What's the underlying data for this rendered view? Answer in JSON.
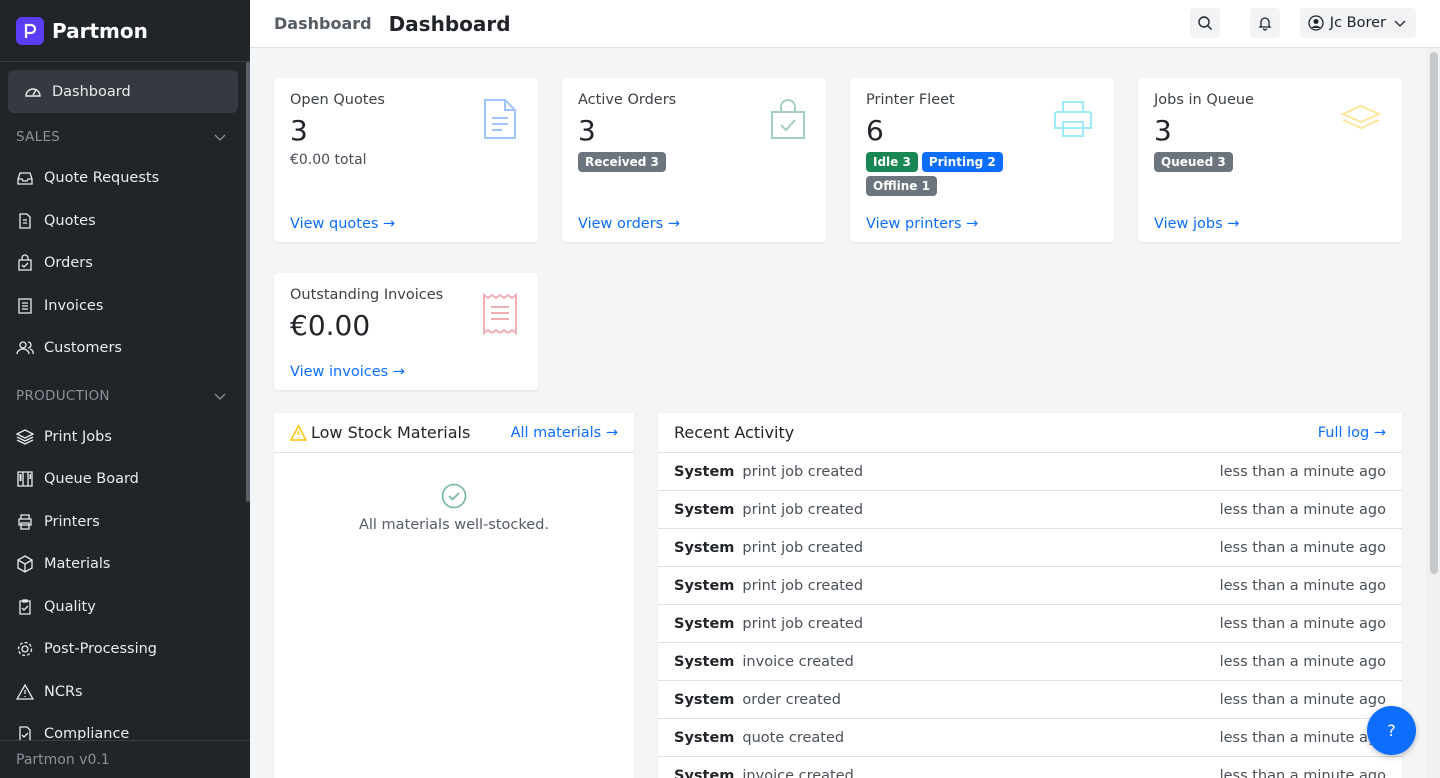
{
  "app": {
    "name": "Partmon",
    "version": "Partmon v0.1"
  },
  "header": {
    "breadcrumb": "Dashboard",
    "title": "Dashboard",
    "user": "Jc Borer"
  },
  "sidebar": {
    "active": "Dashboard",
    "sales_label": "SALES",
    "sales": [
      "Quote Requests",
      "Quotes",
      "Orders",
      "Invoices",
      "Customers"
    ],
    "production_label": "PRODUCTION",
    "production": [
      "Print Jobs",
      "Queue Board",
      "Printers",
      "Materials",
      "Quality",
      "Post-Processing",
      "NCRs",
      "Compliance"
    ]
  },
  "stats": {
    "quotes": {
      "label": "Open Quotes",
      "value": "3",
      "sub": "€0.00 total",
      "link": "View quotes →",
      "color": "#9ec5fe"
    },
    "orders": {
      "label": "Active Orders",
      "value": "3",
      "badge": "Received 3",
      "link": "View orders →",
      "color": "#a3cfbb"
    },
    "printers": {
      "label": "Printer Fleet",
      "value": "6",
      "badges": [
        "Idle 3",
        "Printing 2",
        "Offline 1"
      ],
      "link": "View printers →",
      "color": "#9eeaf9"
    },
    "jobs": {
      "label": "Jobs in Queue",
      "value": "3",
      "badge": "Queued 3",
      "link": "View jobs →",
      "color": "#ffe69c"
    },
    "invoices": {
      "label": "Outstanding Invoices",
      "value": "€0.00",
      "link": "View invoices →",
      "color": "#f1aeb5"
    }
  },
  "low_stock": {
    "title": "Low Stock Materials",
    "link": "All materials →",
    "empty": "All materials well-stocked."
  },
  "activity": {
    "title": "Recent Activity",
    "link": "Full log →",
    "rows": [
      {
        "actor": "System",
        "msg": "print job created",
        "time": "less than a minute ago"
      },
      {
        "actor": "System",
        "msg": "print job created",
        "time": "less than a minute ago"
      },
      {
        "actor": "System",
        "msg": "print job created",
        "time": "less than a minute ago"
      },
      {
        "actor": "System",
        "msg": "print job created",
        "time": "less than a minute ago"
      },
      {
        "actor": "System",
        "msg": "print job created",
        "time": "less than a minute ago"
      },
      {
        "actor": "System",
        "msg": "invoice created",
        "time": "less than a minute ago"
      },
      {
        "actor": "System",
        "msg": "order created",
        "time": "less than a minute ago"
      },
      {
        "actor": "System",
        "msg": "quote created",
        "time": "less than a minute ago"
      },
      {
        "actor": "System",
        "msg": "invoice created",
        "time": "less than a minute ago"
      }
    ]
  },
  "help": {
    "label": "?"
  }
}
